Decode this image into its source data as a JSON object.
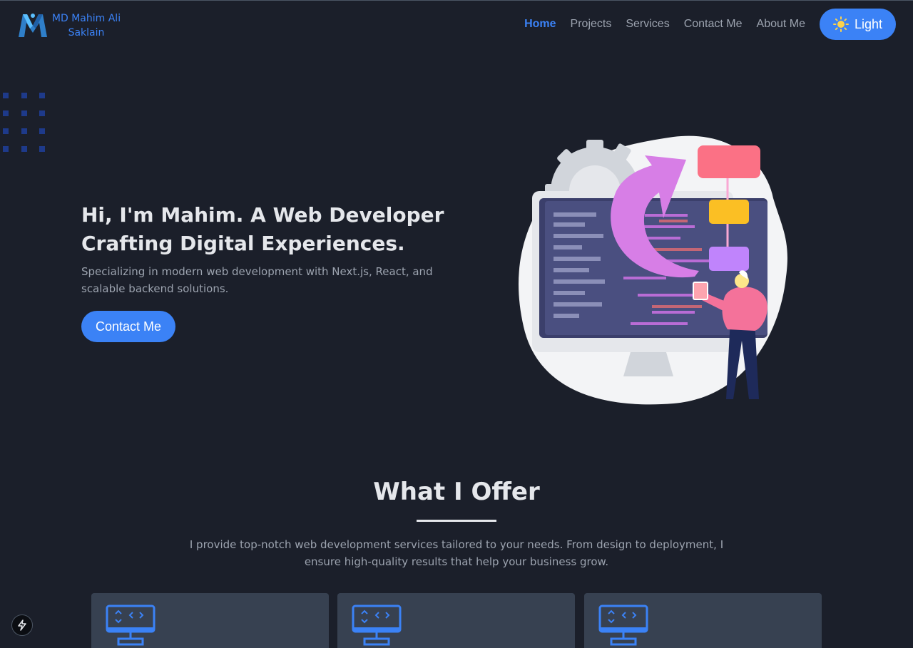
{
  "logo": {
    "line1": "MD Mahim Ali",
    "line2": "Saklain"
  },
  "nav": {
    "links": [
      "Home",
      "Projects",
      "Services",
      "Contact Me",
      "About Me"
    ],
    "active": "Home",
    "theme_label": "Light"
  },
  "hero": {
    "title": "Hi, I'm Mahim. A Web Developer Crafting Digital Experiences.",
    "subtitle": "Specializing in modern web development with Next.js, React, and scalable backend solutions.",
    "cta_label": "Contact Me"
  },
  "offer": {
    "title": "What I Offer",
    "description": "I provide top-notch web development services tailored to your needs. From design to deployment, I ensure high-quality results that help your business grow."
  },
  "icons": {
    "logo": "logo-m-icon",
    "theme": "sun-icon",
    "card": "monitor-code-icon",
    "dev_tool": "lightning-bolt-icon"
  },
  "colors": {
    "background": "#1b1f2a",
    "accent": "#3b82f6",
    "card": "#374151",
    "muted_text": "#9ca3af"
  }
}
